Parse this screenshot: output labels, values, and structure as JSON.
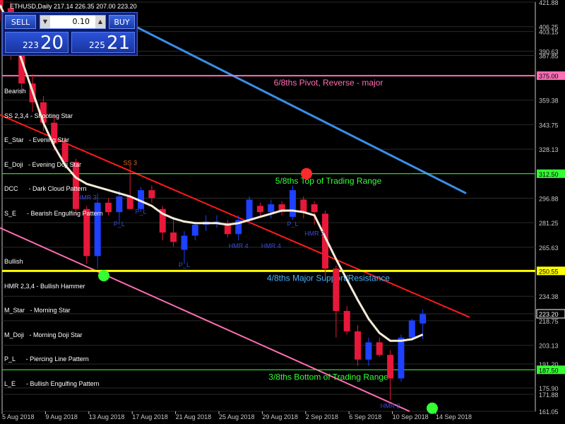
{
  "header": {
    "text": "ETHUSD,Daily  217.14 226.35 207.00 223.20"
  },
  "trade_panel": {
    "sell_label": "SELL",
    "buy_label": "BUY",
    "lot_value": "0.10",
    "sell_price_small": "223",
    "sell_price_big": "20",
    "buy_price_small": "225",
    "buy_price_big": "21"
  },
  "legend": {
    "bearish_title": "Bearish",
    "bearish": [
      "SS 2,3,4 - Shooting Star",
      "E_Star   - Evening Star",
      "E_Doji   - Evening Doji Star",
      "DCC      - Dark Cloud Pattern",
      "S_E      - Bearish Engulfing Pattern"
    ],
    "bullish_title": "Bullish",
    "bullish": [
      "HMR 2,3,4 - Bullish Hammer",
      "M_Star   - Morning Star",
      "M_Doji   - Morning Doji Star",
      "P_L      - Piercing Line Pattern",
      "L_E      - Bullish Engulfing Pattern"
    ]
  },
  "colors": {
    "background": "#000000",
    "bull_candle": "#1e40ff",
    "bear_candle": "#e8183a",
    "moving_average": "#f5ecd7",
    "downtrend_line": "#ff1a1a",
    "upper_channel": "#3a8ee8",
    "lower_channel": "#ff6eb4",
    "pivot_major": "#ff6eb4",
    "top_range": "#33ff33",
    "major_support": "#ffff00",
    "bottom_range": "#33ff33"
  },
  "chart_data": {
    "type": "candlestick",
    "symbol": "ETHUSD",
    "timeframe": "Daily",
    "ylim": [
      161.05,
      421.88
    ],
    "price_axis_ticks": [
      421.88,
      406.25,
      403.15,
      390.63,
      387.85,
      375.0,
      359.38,
      343.75,
      328.13,
      312.5,
      296.88,
      281.25,
      265.63,
      250.55,
      234.38,
      223.2,
      218.75,
      203.13,
      191.2,
      187.5,
      175.9,
      171.88,
      161.05
    ],
    "highlighted_prices": [
      {
        "label": "375.00",
        "color": "pivot"
      },
      {
        "label": "312.50",
        "color": "top"
      },
      {
        "label": "250.55",
        "color": "support"
      },
      {
        "label": "223.20",
        "color": "current"
      },
      {
        "label": "187.50",
        "color": "bottom"
      }
    ],
    "date_labels": [
      "5 Aug 2018",
      "9 Aug 2018",
      "13 Aug 2018",
      "17 Aug 2018",
      "21 Aug 2018",
      "25 Aug 2018",
      "29 Aug 2018",
      "2 Sep 2018",
      "6 Sep 2018",
      "10 Sep 2018",
      "14 Sep 2018"
    ],
    "levels": [
      {
        "name": "6/8ths Pivot, Reverse - major",
        "price": 375.0,
        "color": "pivot"
      },
      {
        "name": "5/8ths Top of Trading Range",
        "price": 312.5,
        "color": "top"
      },
      {
        "name": "4/8ths Major Support/Resistance",
        "price": 250.55,
        "color": "support"
      },
      {
        "name": "3/8ths Bottom of Trading Range",
        "price": 187.5,
        "color": "bottom"
      }
    ],
    "candles": [
      {
        "o": 426,
        "h": 430,
        "l": 410,
        "c": 420
      },
      {
        "o": 418,
        "h": 422,
        "l": 385,
        "c": 392
      },
      {
        "o": 392,
        "h": 398,
        "l": 365,
        "c": 370
      },
      {
        "o": 370,
        "h": 376,
        "l": 352,
        "c": 358
      },
      {
        "o": 358,
        "h": 362,
        "l": 340,
        "c": 345
      },
      {
        "o": 345,
        "h": 350,
        "l": 327,
        "c": 332
      },
      {
        "o": 332,
        "h": 336,
        "l": 316,
        "c": 320
      },
      {
        "o": 320,
        "h": 322,
        "l": 286,
        "c": 290
      },
      {
        "o": 290,
        "h": 292,
        "l": 255,
        "c": 260
      },
      {
        "o": 260,
        "h": 300,
        "l": 252,
        "c": 294
      },
      {
        "o": 294,
        "h": 297,
        "l": 286,
        "c": 288
      },
      {
        "o": 288,
        "h": 302,
        "l": 280,
        "c": 298
      },
      {
        "o": 298,
        "h": 318,
        "l": 290,
        "c": 290
      },
      {
        "o": 290,
        "h": 304,
        "l": 288,
        "c": 302
      },
      {
        "o": 302,
        "h": 305,
        "l": 294,
        "c": 297
      },
      {
        "o": 290,
        "h": 292,
        "l": 270,
        "c": 275
      },
      {
        "o": 275,
        "h": 285,
        "l": 266,
        "c": 269
      },
      {
        "o": 264,
        "h": 276,
        "l": 255,
        "c": 273
      },
      {
        "o": 273,
        "h": 282,
        "l": 270,
        "c": 280
      },
      {
        "o": 280,
        "h": 286,
        "l": 276,
        "c": 282
      },
      {
        "o": 282,
        "h": 286,
        "l": 278,
        "c": 282
      },
      {
        "o": 281,
        "h": 283,
        "l": 272,
        "c": 274
      },
      {
        "o": 274,
        "h": 286,
        "l": 270,
        "c": 283
      },
      {
        "o": 283,
        "h": 298,
        "l": 280,
        "c": 296
      },
      {
        "o": 292,
        "h": 294,
        "l": 286,
        "c": 288
      },
      {
        "o": 288,
        "h": 296,
        "l": 284,
        "c": 293
      },
      {
        "o": 293,
        "h": 295,
        "l": 286,
        "c": 288
      },
      {
        "o": 285,
        "h": 305,
        "l": 283,
        "c": 302
      },
      {
        "o": 296,
        "h": 298,
        "l": 284,
        "c": 288
      },
      {
        "o": 293,
        "h": 295,
        "l": 280,
        "c": 288
      },
      {
        "o": 287,
        "h": 289,
        "l": 246,
        "c": 252
      },
      {
        "o": 252,
        "h": 254,
        "l": 208,
        "c": 225
      },
      {
        "o": 225,
        "h": 228,
        "l": 210,
        "c": 212
      },
      {
        "o": 212,
        "h": 216,
        "l": 190,
        "c": 194
      },
      {
        "o": 194,
        "h": 208,
        "l": 190,
        "c": 205
      },
      {
        "o": 205,
        "h": 208,
        "l": 196,
        "c": 197
      },
      {
        "o": 197,
        "h": 200,
        "l": 168,
        "c": 182
      },
      {
        "o": 182,
        "h": 210,
        "l": 180,
        "c": 208
      },
      {
        "o": 208,
        "h": 220,
        "l": 206,
        "c": 219
      },
      {
        "o": 217,
        "h": 226,
        "l": 207,
        "c": 223
      }
    ],
    "markers": [
      {
        "label": "HMR 3",
        "candle": 8,
        "price": 296,
        "color": "#3a4adb"
      },
      {
        "label": "SS 3",
        "candle": 12,
        "price": 318,
        "color": "#e06a1a"
      },
      {
        "label": "P_L",
        "candle": 11,
        "price": 279,
        "color": "#3a4adb"
      },
      {
        "label": "P_L",
        "candle": 13,
        "price": 287,
        "color": "#3a4adb"
      },
      {
        "label": "P_L",
        "candle": 17,
        "price": 253,
        "color": "#3a4adb"
      },
      {
        "label": "HMR 4",
        "candle": 22,
        "price": 265,
        "color": "#3a4adb"
      },
      {
        "label": "HMR 4",
        "candle": 25,
        "price": 265,
        "color": "#3a4adb"
      },
      {
        "label": "P_L",
        "candle": 27,
        "price": 279,
        "color": "#3a4adb"
      },
      {
        "label": "HMR 2",
        "candle": 29,
        "price": 273,
        "color": "#3a4adb"
      },
      {
        "label": "HMR 2",
        "candle": 36,
        "price": 163,
        "color": "#3a4adb"
      }
    ],
    "moving_average": [
      420,
      405,
      385,
      365,
      345,
      330,
      318,
      310,
      306,
      304,
      302,
      300,
      298,
      295,
      292,
      287,
      284,
      282,
      281,
      281,
      281,
      280,
      281,
      283,
      285,
      287,
      289,
      289,
      288,
      286,
      272,
      258,
      245,
      232,
      220,
      211,
      206,
      206,
      207,
      210
    ]
  }
}
